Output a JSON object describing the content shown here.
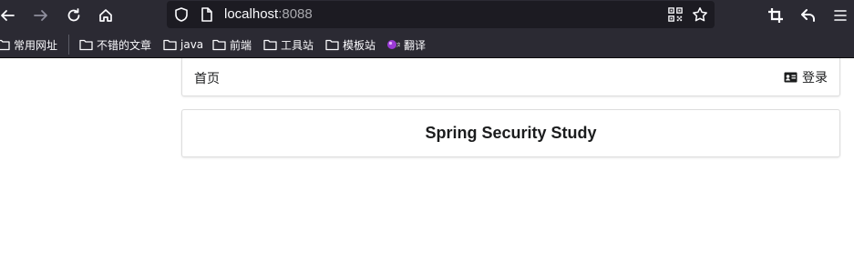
{
  "browser": {
    "url_host": "localhost",
    "url_port": ":8088",
    "colors": {
      "toolbar": "#2b2a33",
      "urlbar": "#1c1b22",
      "text": "#fbfbfe"
    }
  },
  "bookmarks": [
    {
      "label": "常用网址",
      "icon": "folder-icon"
    },
    {
      "label": "不错的文章",
      "icon": "folder-icon"
    },
    {
      "label": "java",
      "icon": "folder-icon"
    },
    {
      "label": "前端",
      "icon": "folder-icon"
    },
    {
      "label": "工具站",
      "icon": "folder-icon"
    },
    {
      "label": "模板站",
      "icon": "folder-icon"
    },
    {
      "label": "翻译",
      "icon": "translate-icon"
    }
  ],
  "nav": {
    "home_label": "首页",
    "login_label": "登录",
    "login_icon": "id-card-icon"
  },
  "main": {
    "title": "Spring Security Study"
  }
}
